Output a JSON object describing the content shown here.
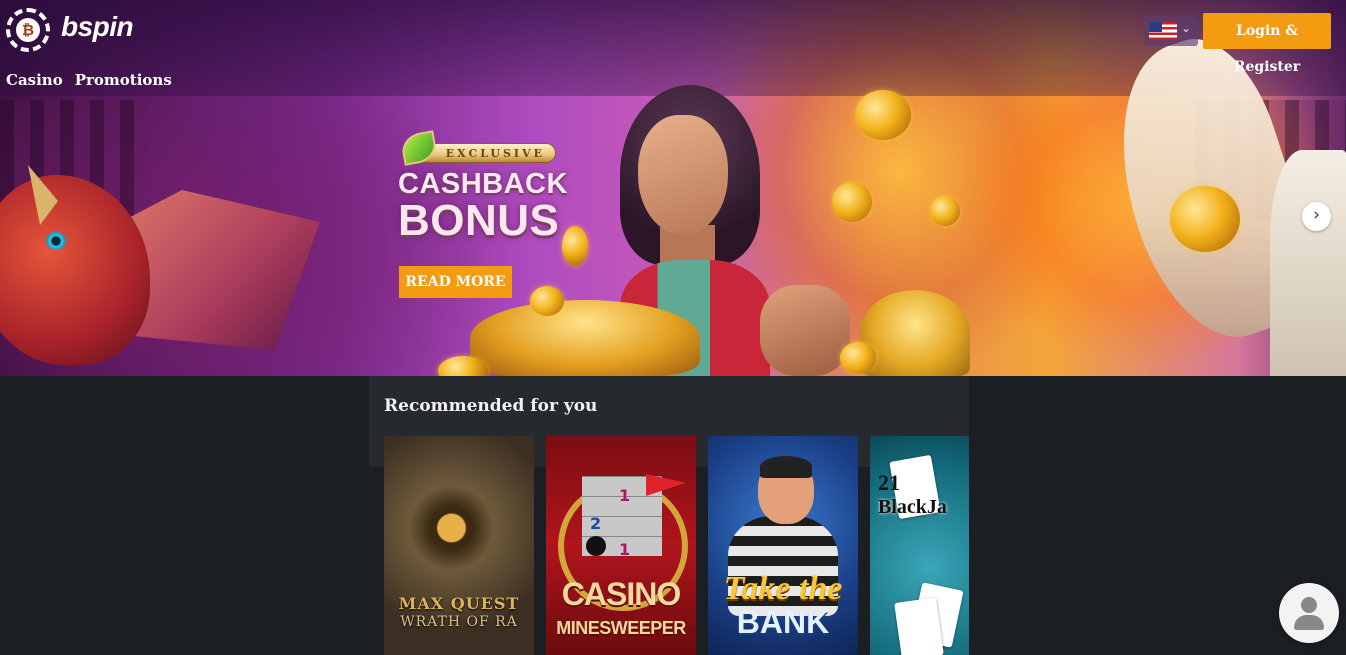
{
  "header": {
    "brand": "bspin",
    "nav": [
      {
        "label": "Casino"
      },
      {
        "label": "Promotions"
      }
    ],
    "login_label": "Login & Register",
    "language_flag": "us-flag-icon"
  },
  "hero": {
    "badge": "EXCLUSIVE",
    "title_line1": "CASHBACK",
    "title_line2": "BONUS",
    "cta": "READ MORE"
  },
  "recommended": {
    "title": "Recommended for you",
    "games": [
      {
        "line1": "MAX QUEST",
        "line2": "WRATH OF RA"
      },
      {
        "line1": "CASINO",
        "line2": "MINESWEEPER",
        "grid_numbers": [
          "1",
          "2",
          "1"
        ]
      },
      {
        "line1": "Take the",
        "line2": "BANK"
      },
      {
        "line1": "21",
        "line2": "BlackJa"
      }
    ]
  },
  "colors": {
    "accent": "#f39b11",
    "background": "#1b1e22",
    "panel": "#262a2f"
  }
}
